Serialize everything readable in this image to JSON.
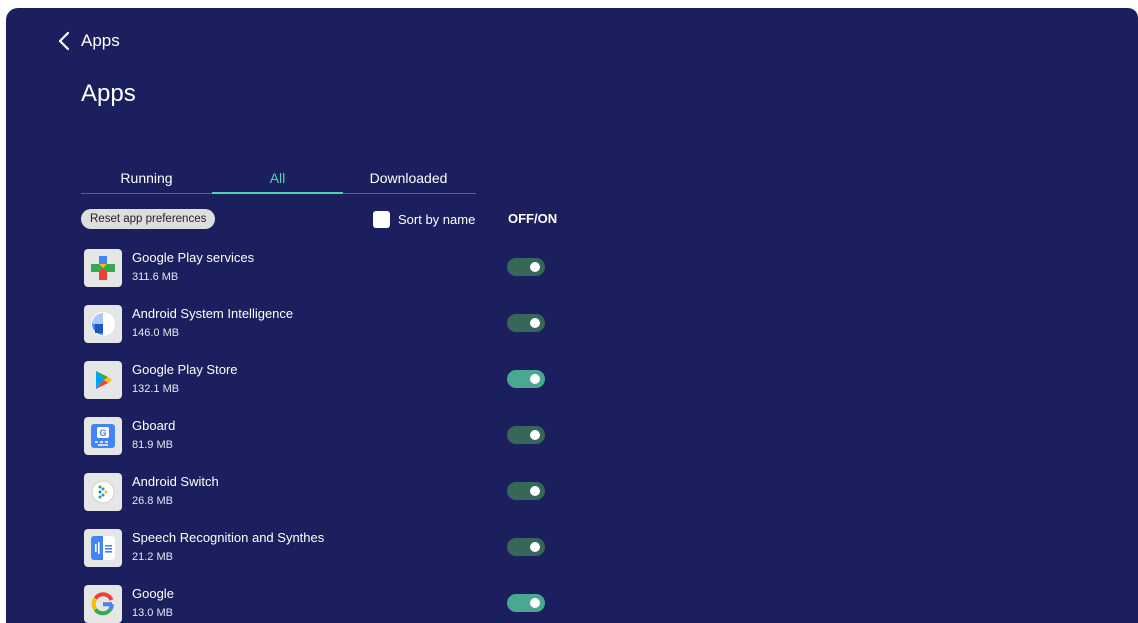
{
  "header": {
    "back_label": "Apps",
    "page_title": "Apps"
  },
  "tabs": [
    {
      "label": "Running",
      "active": false
    },
    {
      "label": "All",
      "active": true
    },
    {
      "label": "Downloaded",
      "active": false
    }
  ],
  "controls": {
    "reset_label": "Reset app preferences",
    "sort_label": "Sort by name",
    "sort_checked": false,
    "offon_label": "OFF/ON"
  },
  "apps": [
    {
      "name": "Google Play services",
      "size": "311.6 MB",
      "icon": "google-play-services-icon",
      "enabled": true
    },
    {
      "name": "Android System Intelligence",
      "size": "146.0 MB",
      "icon": "android-system-intelligence-icon",
      "enabled": true
    },
    {
      "name": "Google Play Store",
      "size": "132.1 MB",
      "icon": "google-play-store-icon",
      "enabled": true
    },
    {
      "name": "Gboard",
      "size": "81.9 MB",
      "icon": "gboard-icon",
      "enabled": true
    },
    {
      "name": "Android Switch",
      "size": "26.8 MB",
      "icon": "android-switch-icon",
      "enabled": true
    },
    {
      "name": "Speech Recognition and Synthes",
      "size": "21.2 MB",
      "icon": "speech-recognition-icon",
      "enabled": true
    },
    {
      "name": "Google",
      "size": "13.0 MB",
      "icon": "google-icon",
      "enabled": true
    }
  ],
  "colors": {
    "background": "#1c1f5e",
    "accent": "#4fd3b0",
    "toggle_on": "#36685a",
    "toggle_on_bright": "#4aa892"
  }
}
